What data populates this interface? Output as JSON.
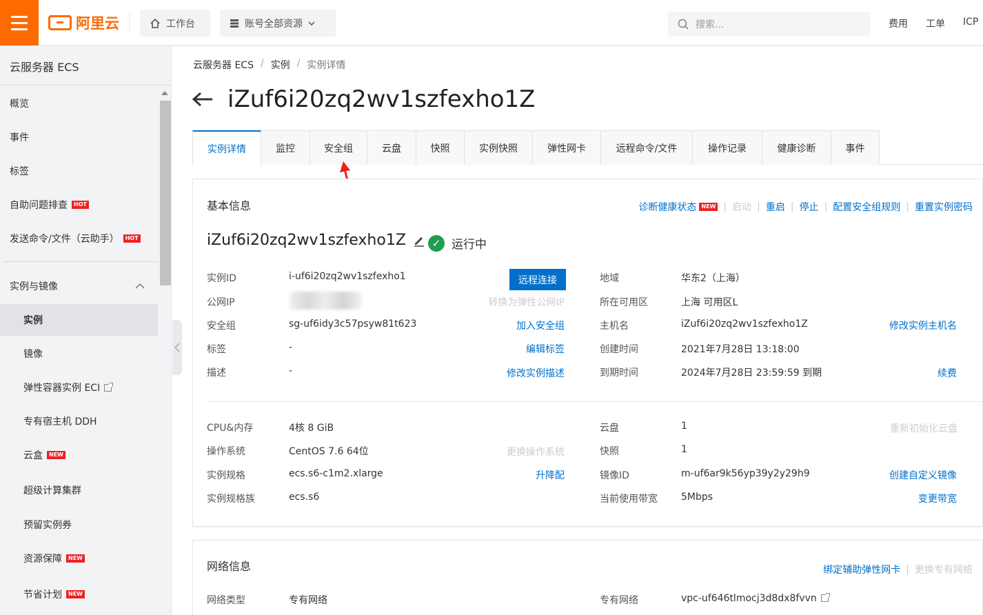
{
  "topbar": {
    "logo_text": "阿里云",
    "workbench": "工作台",
    "resources": "账号全部资源",
    "search_placeholder": "搜索...",
    "links": [
      "费用",
      "工单",
      "ICP"
    ],
    "accent_color": "#ff6a00"
  },
  "sidebar": {
    "title": "云服务器 ECS",
    "items": [
      {
        "label": "概览"
      },
      {
        "label": "事件"
      },
      {
        "label": "标签"
      },
      {
        "label": "自助问题排查",
        "badge": "HOT"
      },
      {
        "label": "发送命令/文件（云助手）",
        "badge": "HOT"
      },
      {
        "label": "实例与镜像"
      },
      {
        "label": "实例"
      },
      {
        "label": "镜像"
      },
      {
        "label": "弹性容器实例 ECI"
      },
      {
        "label": "专有宿主机 DDH"
      },
      {
        "label": "云盒",
        "badge": "NEW"
      },
      {
        "label": "超级计算集群"
      },
      {
        "label": "预留实例券"
      },
      {
        "label": "资源保障",
        "badge": "NEW"
      },
      {
        "label": "节省计划",
        "badge": "NEW"
      }
    ]
  },
  "breadcrumb": [
    "云服务器 ECS",
    "实例",
    "实例详情"
  ],
  "page_title": "iZuf6i20zq2wv1szfexho1Z",
  "tabs": [
    "实例详情",
    "监控",
    "安全组",
    "云盘",
    "快照",
    "实例快照",
    "弹性网卡",
    "远程命令/文件",
    "操作记录",
    "健康诊断",
    "事件"
  ],
  "basic": {
    "title": "基本信息",
    "actions": {
      "diagnose": "诊断健康状态",
      "start": "启动",
      "restart": "重启",
      "stop": "停止",
      "config_sg": "配置安全组规则",
      "reset_pwd": "重置实例密码"
    },
    "name": "iZuf6i20zq2wv1szfexho1Z",
    "status": "运行中",
    "instance_id_label": "实例ID",
    "instance_id": "i-uf6i20zq2wv1szfexho1",
    "remote_btn": "远程连接",
    "public_ip_label": "公网IP",
    "public_ip_action": "转换为弹性公网IP",
    "sg_label": "安全组",
    "sg_value": "sg-uf6idy3c57psyw81t623",
    "sg_action": "加入安全组",
    "tag_label": "标签",
    "tag_value": "-",
    "tag_action": "编辑标签",
    "desc_label": "描述",
    "desc_value": "-",
    "desc_action": "修改实例描述",
    "region_label": "地域",
    "region_value": "华东2（上海）",
    "zone_label": "所在可用区",
    "zone_value": "上海 可用区L",
    "host_label": "主机名",
    "host_value": "iZuf6i20zq2wv1szfexho1Z",
    "host_action": "修改实例主机名",
    "created_label": "创建时间",
    "created_value": "2021年7月28日 13:18:00",
    "expire_label": "到期时间",
    "expire_value": "2024年7月28日 23:59:59 到期",
    "expire_action": "续费",
    "cpu_label": "CPU&内存",
    "cpu_value": "4核 8 GiB",
    "os_label": "操作系统",
    "os_value": "CentOS 7.6 64位",
    "os_action": "更换操作系统",
    "spec_label": "实例规格",
    "spec_value": "ecs.s6-c1m2.xlarge",
    "spec_action": "升降配",
    "family_label": "实例规格族",
    "family_value": "ecs.s6",
    "disk_label": "云盘",
    "disk_value": "1",
    "disk_action": "重新初始化云盘",
    "snap_label": "快照",
    "snap_value": "1",
    "image_label": "镜像ID",
    "image_value": "m-uf6ar9k56yp39y2y29h9",
    "image_action": "创建自定义镜像",
    "bw_label": "当前使用带宽",
    "bw_value": "5Mbps",
    "bw_action": "变更带宽"
  },
  "network": {
    "title": "网络信息",
    "bind_eni": "绑定辅助弹性网卡",
    "change_vpc": "更换专有网络",
    "type_label": "网络类型",
    "type_value": "专有网络",
    "vpc_label": "专有网络",
    "vpc_value": "vpc-uf646tlmocj3d8dx8fvvn"
  }
}
